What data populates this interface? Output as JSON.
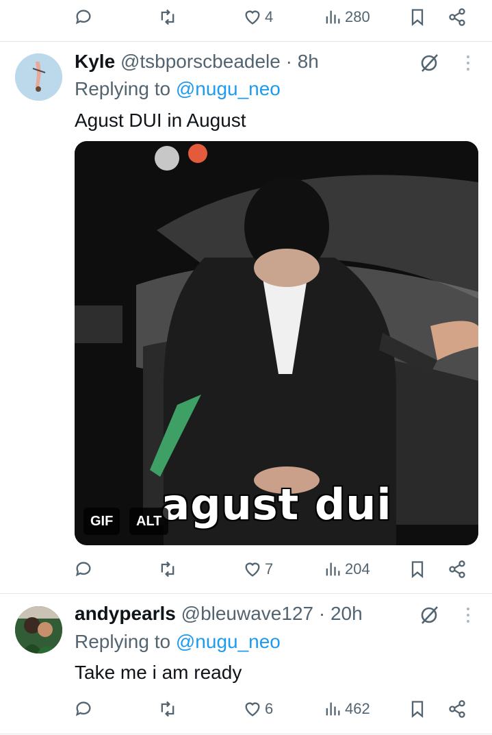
{
  "top_actions": {
    "likes": "4",
    "views": "280"
  },
  "tweets": [
    {
      "display_name": "Kyle",
      "handle": "@tsbporscbeadele",
      "time": "· 8h",
      "replying_prefix": "Replying to",
      "replying_to": "@nugu_neo",
      "text": "Agust DUI in August",
      "media": {
        "caption": "agust dui",
        "gif_badge": "GIF",
        "alt_badge": "ALT"
      },
      "actions": {
        "likes": "7",
        "views": "204"
      }
    },
    {
      "display_name": "andypearls",
      "handle": "@bleuwave127",
      "time": "· 20h",
      "replying_prefix": "Replying to",
      "replying_to": "@nugu_neo",
      "text": "Take me i am ready",
      "actions": {
        "likes": "6",
        "views": "462"
      }
    }
  ],
  "colors": {
    "text": "#0f1419",
    "secondary": "#536471",
    "link": "#1d9bf0",
    "divider": "#e3e7ea"
  },
  "icons": [
    "reply-icon",
    "retweet-icon",
    "heart-icon",
    "views-icon",
    "bookmark-icon",
    "share-icon",
    "grok-icon",
    "more-icon"
  ]
}
